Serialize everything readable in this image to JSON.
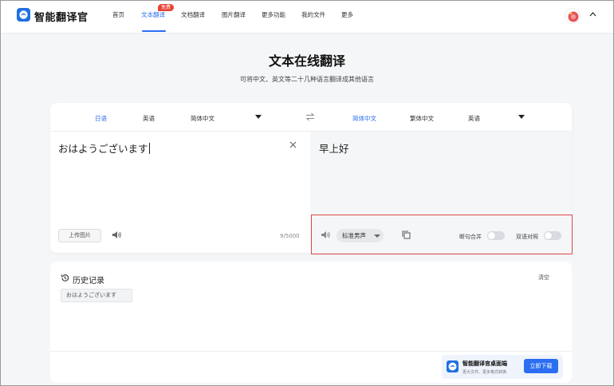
{
  "header": {
    "brand": "智能翻译官",
    "nav": [
      {
        "label": "首页"
      },
      {
        "label": "文本翻译",
        "active": true,
        "badge": "免费"
      },
      {
        "label": "文档翻译"
      },
      {
        "label": "图片翻译"
      },
      {
        "label": "更多功能"
      },
      {
        "label": "我的文件"
      },
      {
        "label": "更多"
      }
    ]
  },
  "page": {
    "title": "文本在线翻译",
    "subtitle": "可将中文、英文等二十几种语言翻译成其他语言"
  },
  "translator": {
    "source_langs": [
      "日语",
      "英语",
      "简体中文"
    ],
    "source_active": "日语",
    "target_langs": [
      "简体中文",
      "繁体中文",
      "英语"
    ],
    "target_active": "简体中文",
    "source_text": "おはようございます",
    "target_text": "早上好",
    "upload_label": "上传图片",
    "char_count": "9/5000",
    "voice": "标准男声",
    "toggle_merge": "断句合并",
    "toggle_bilingual": "双语对照"
  },
  "history": {
    "title": "历史记录",
    "clear": "清空",
    "items": [
      "おはようございます"
    ]
  },
  "promo": {
    "title": "智能翻译官桌面端",
    "subtitle": "更大文件、更多格式转换",
    "button": "立即下载"
  },
  "colors": {
    "accent": "#2b6ef2",
    "badge": "#e94335",
    "highlight": "#e04848"
  }
}
